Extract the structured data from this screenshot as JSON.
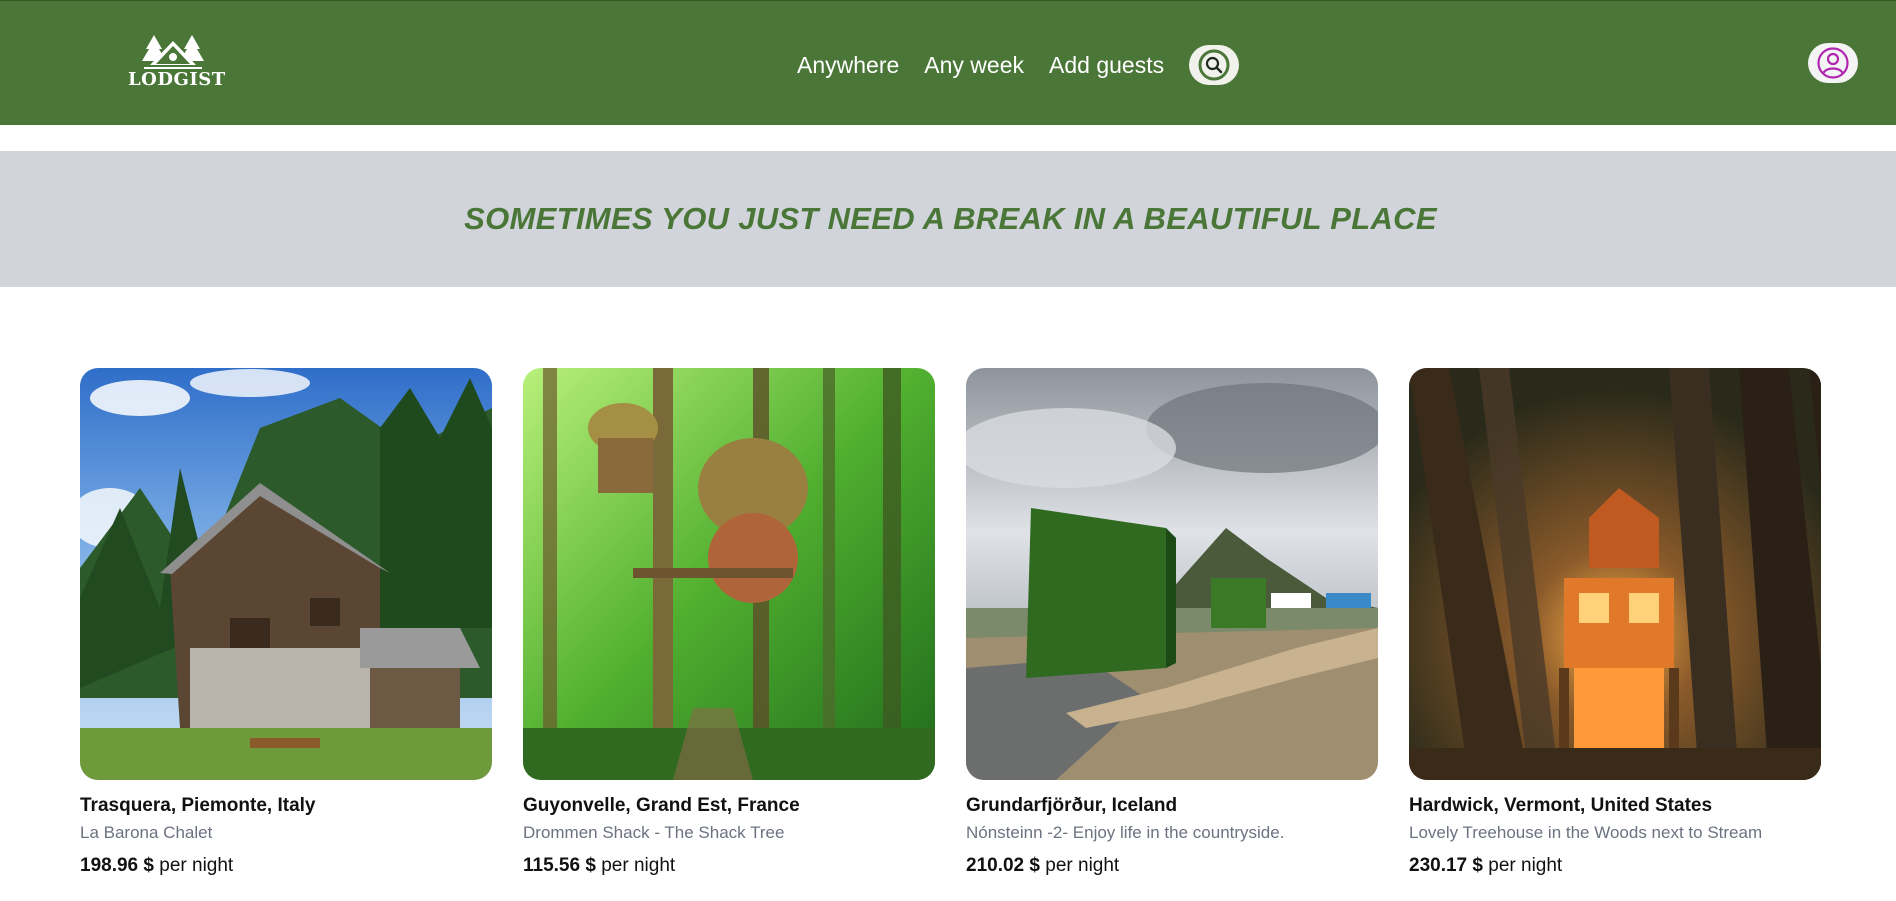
{
  "header": {
    "logo_text": "LODGIST",
    "nav": [
      "Anywhere",
      "Any week",
      "Add guests"
    ],
    "search_icon": "search-icon",
    "user_icon": "user-circle-icon",
    "colors": {
      "primary": "#4a7637",
      "search_ring": "#4a7637",
      "user_accent": "#b026b0"
    }
  },
  "banner": {
    "text": "SOMETIMES YOU JUST NEED A BREAK IN A BEAUTIFUL PLACE",
    "background": "#d1d5db"
  },
  "listings": [
    {
      "location": "Trasquera, Piemonte, Italy",
      "title": "La Barona Chalet",
      "price": "198.96",
      "currency": "$",
      "unit": "per night"
    },
    {
      "location": "Guyonvelle, Grand Est, France",
      "title": "Drommen Shack - The Shack Tree",
      "price": "115.56",
      "currency": "$",
      "unit": "per night"
    },
    {
      "location": "Grundarfjörður, Iceland",
      "title": "Nónsteinn -2- Enjoy life in the countryside.",
      "price": "210.02",
      "currency": "$",
      "unit": "per night"
    },
    {
      "location": "Hardwick, Vermont, United States",
      "title": "Lovely Treehouse in the Woods next to Stream",
      "price": "230.17",
      "currency": "$",
      "unit": "per night"
    }
  ]
}
